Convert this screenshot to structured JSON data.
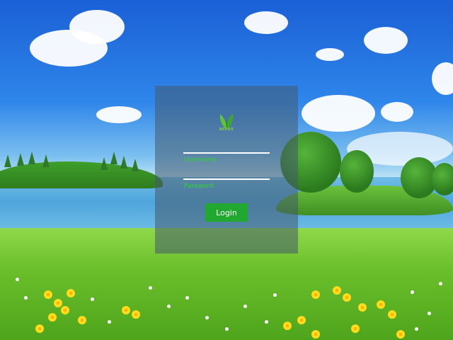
{
  "login": {
    "logo_text": "REPOS",
    "username_placeholder": "Username",
    "password_placeholder": "Password",
    "login_label": "Login"
  },
  "colors": {
    "accent": "#20a830",
    "label": "#2fd62f"
  },
  "icons": {
    "logo": "leaf-logo-icon"
  }
}
